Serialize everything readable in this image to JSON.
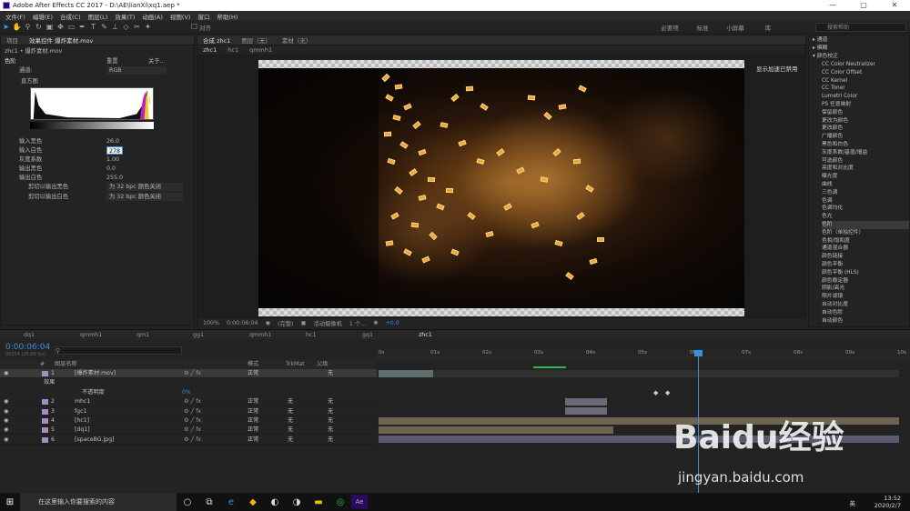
{
  "window": {
    "title": "Adobe After Effects CC 2017 - D:\\AE\\lianXi\\xq1.aep *",
    "controls": [
      "—",
      "▢",
      "✕"
    ]
  },
  "menu": [
    "文件(F)",
    "编辑(E)",
    "合成(C)",
    "图层(L)",
    "效果(T)",
    "动画(A)",
    "视图(V)",
    "窗口",
    "帮助(H)"
  ],
  "toolbar": {
    "snap_label": "对齐",
    "workspaces": [
      "必要项",
      "标准",
      "小屏幕",
      "库"
    ],
    "search_placeholder": "搜索帮助"
  },
  "effects_panel": {
    "tab_project": "项目",
    "tab_effects": "效果控件 爆炸素材.mov",
    "breadcrumb": "zhc1 • 爆炸素材.mov",
    "effect_name": "色阶",
    "reset": "重置",
    "about": "关于...",
    "channel_label": "通道:",
    "channel_value": "RGB",
    "histogram_label": "直方图",
    "params": [
      {
        "label": "输入黑色",
        "value": "26.0"
      },
      {
        "label": "输入白色",
        "value": "278"
      },
      {
        "label": "灰度系数",
        "value": "1.00"
      },
      {
        "label": "输出黑色",
        "value": "0.0"
      },
      {
        "label": "输出白色",
        "value": "255.0"
      }
    ],
    "clip": [
      {
        "label": "剪切以输出黑色",
        "value": "为 32 bpc 颜色关闭"
      },
      {
        "label": "剪切以输出白色",
        "value": "为 32 bpc 颜色关闭"
      }
    ]
  },
  "comp_panel": {
    "tab_comp": "合成 zhc1",
    "tab_layer": "图层（无）",
    "tab_footage": "素材（无）",
    "subtabs": [
      "zhc1",
      "hc1",
      "qmmh1"
    ],
    "gpu_note": "显示加速已禁用",
    "footer": {
      "zoom": "100%",
      "timecode": "0:00:06:04",
      "resolution": "(完整)",
      "camera": "活动摄像机",
      "views": "1 个...",
      "exposure": "+0.0"
    }
  },
  "effects_list": {
    "header": [
      "▸ 通道",
      "▸ 模糊",
      "▾ 颜色校正"
    ],
    "items": [
      "CC Color Neutralizer",
      "CC Color Offset",
      "CC Kernel",
      "CC Toner",
      "Lumetri Color",
      "PS 任意映射",
      "保留颜色",
      "更改为颜色",
      "更改颜色",
      "广播颜色",
      "黑色和白色",
      "灰度系数/基值/增益",
      "可选颜色",
      "亮度和对比度",
      "曝光度",
      "曲线",
      "三色调",
      "色调",
      "色调均化",
      "色光",
      "色阶",
      "色阶（单独控件）",
      "色相/饱和度",
      "通道混合器",
      "颜色链接",
      "颜色平衡",
      "颜色平衡 (HLS)",
      "颜色稳定器",
      "阴影/高光",
      "照片滤镜",
      "自动对比度",
      "自动色阶",
      "自动颜色"
    ],
    "selected_index": 20
  },
  "timeline": {
    "tabs": [
      "dq1",
      "qmmh1",
      "qm1",
      "gg1",
      "qmmh1",
      "hc1",
      "gq1",
      "zhc1"
    ],
    "current_tab": 7,
    "timecode": "0:00:06:04",
    "timecode_sub": "00154 (25.00 fps)",
    "columns": {
      "num": "#",
      "name": "图层名称",
      "mode": "模式",
      "trkmat": "TrkMat",
      "parent": "父级"
    },
    "layers": [
      {
        "num": "1",
        "name": "[爆炸素材.mov]",
        "mode": "正常",
        "trkmat": "",
        "parent": "无",
        "color": "#a58ec0"
      },
      {
        "num": "2",
        "name": "mhc1",
        "mode": "正常",
        "trkmat": "无",
        "parent": "无",
        "color": "#a58ec0"
      },
      {
        "num": "3",
        "name": "fgc1",
        "mode": "正常",
        "trkmat": "无",
        "parent": "无",
        "color": "#a58ec0"
      },
      {
        "num": "4",
        "name": "[hc1]",
        "mode": "正常",
        "trkmat": "无",
        "parent": "无",
        "color": "#a58ec0"
      },
      {
        "num": "5",
        "name": "[dq1]",
        "mode": "正常",
        "trkmat": "无",
        "parent": "无",
        "color": "#a58ec0"
      },
      {
        "num": "6",
        "name": "[spaceBG.jpg]",
        "mode": "正常",
        "trkmat": "无",
        "parent": "无",
        "color": "#a58ec0"
      }
    ],
    "effects_row": "效果",
    "opacity_label": "不透明度",
    "opacity_value": "0%",
    "ruler": [
      "0s",
      "01s",
      "02s",
      "03s",
      "04s",
      "05s",
      "06s",
      "07s",
      "08s",
      "09s",
      "10s"
    ]
  },
  "taskbar": {
    "search_placeholder": "在这里输入你要搜索的内容",
    "time": "13:52",
    "date": "2020/2/7",
    "lang": "英"
  },
  "watermark": {
    "text": "Baidu经验",
    "url": "jingyan.baidu.com"
  }
}
